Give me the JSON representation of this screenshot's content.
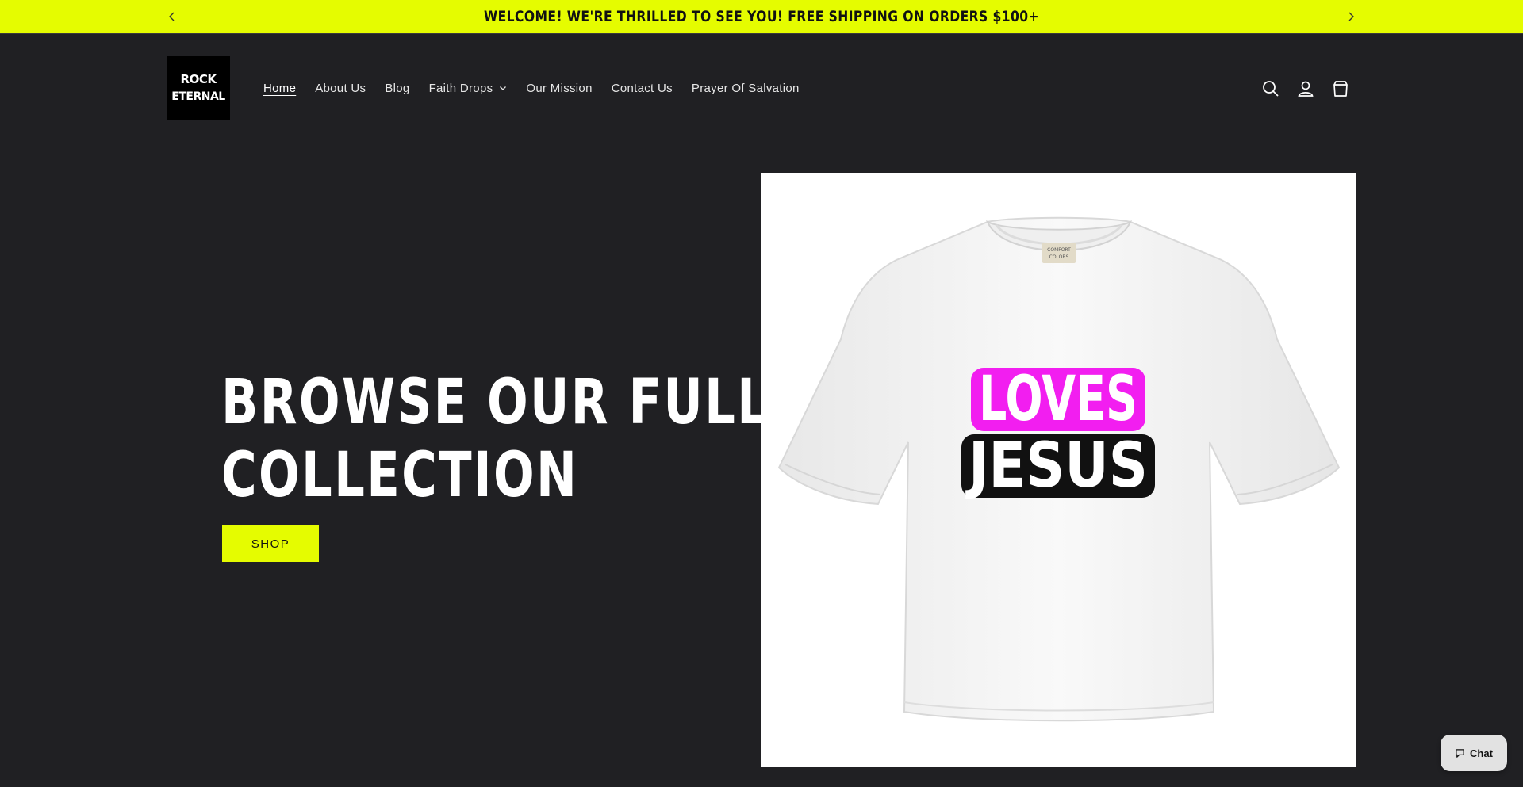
{
  "announcement": {
    "text": "WELCOME! WE'RE THRILLED TO SEE YOU! FREE SHIPPING ON ORDERS $100+",
    "background_color": "#e5fc00"
  },
  "header": {
    "logo": {
      "line1": "ROCK",
      "line2": "ETERNAL"
    },
    "nav": [
      {
        "label": "Home",
        "active": true
      },
      {
        "label": "About Us"
      },
      {
        "label": "Blog"
      },
      {
        "label": "Faith Drops",
        "has_dropdown": true
      },
      {
        "label": "Our Mission"
      },
      {
        "label": "Contact Us"
      },
      {
        "label": "Prayer Of Salvation"
      }
    ],
    "icons": [
      "search-icon",
      "account-icon",
      "cart-icon"
    ]
  },
  "hero": {
    "title_line1": "BROWSE OUR FULL",
    "title_line2": "COLLECTION",
    "button_label": "SHOP",
    "accent_color": "#e5fc00",
    "background_color": "#202023"
  },
  "product_image": {
    "shirt_label_line1": "COMFORT",
    "shirt_label_line2": "COLORS",
    "graphic_line1": "LOVES",
    "graphic_line2": "JESUS",
    "graphic_line1_color": "#f21ef0",
    "graphic_line2_color": "#111111"
  },
  "chat": {
    "label": "Chat"
  }
}
